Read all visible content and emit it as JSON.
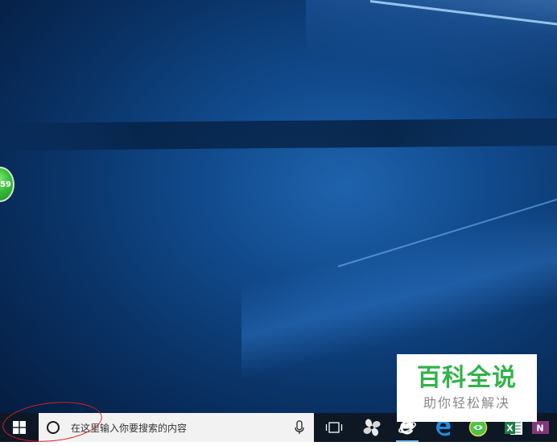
{
  "desktop": {
    "widget_value": "59"
  },
  "taskbar": {
    "search": {
      "placeholder": "在这里输入你要搜索的内容"
    },
    "pinned": [
      {
        "name": "task-view",
        "icon": "task-view-icon"
      },
      {
        "name": "pinwheel-app",
        "icon": "pinwheel-icon"
      },
      {
        "name": "internet-explorer",
        "icon": "ie-icon"
      },
      {
        "name": "edge",
        "icon": "edge-icon"
      },
      {
        "name": "360-browser",
        "icon": "green-browser-icon"
      },
      {
        "name": "excel",
        "icon": "excel-icon",
        "letter": "X"
      },
      {
        "name": "onenote",
        "icon": "onenote-icon",
        "letter": "N"
      }
    ]
  },
  "watermark": {
    "title": "百科全说",
    "subtitle": "助你轻松解决"
  },
  "colors": {
    "taskbar_bg": "#0d1824",
    "search_bg": "#f2f2f2",
    "watermark_green": "#32b34a",
    "annotation_red": "#d32020"
  }
}
